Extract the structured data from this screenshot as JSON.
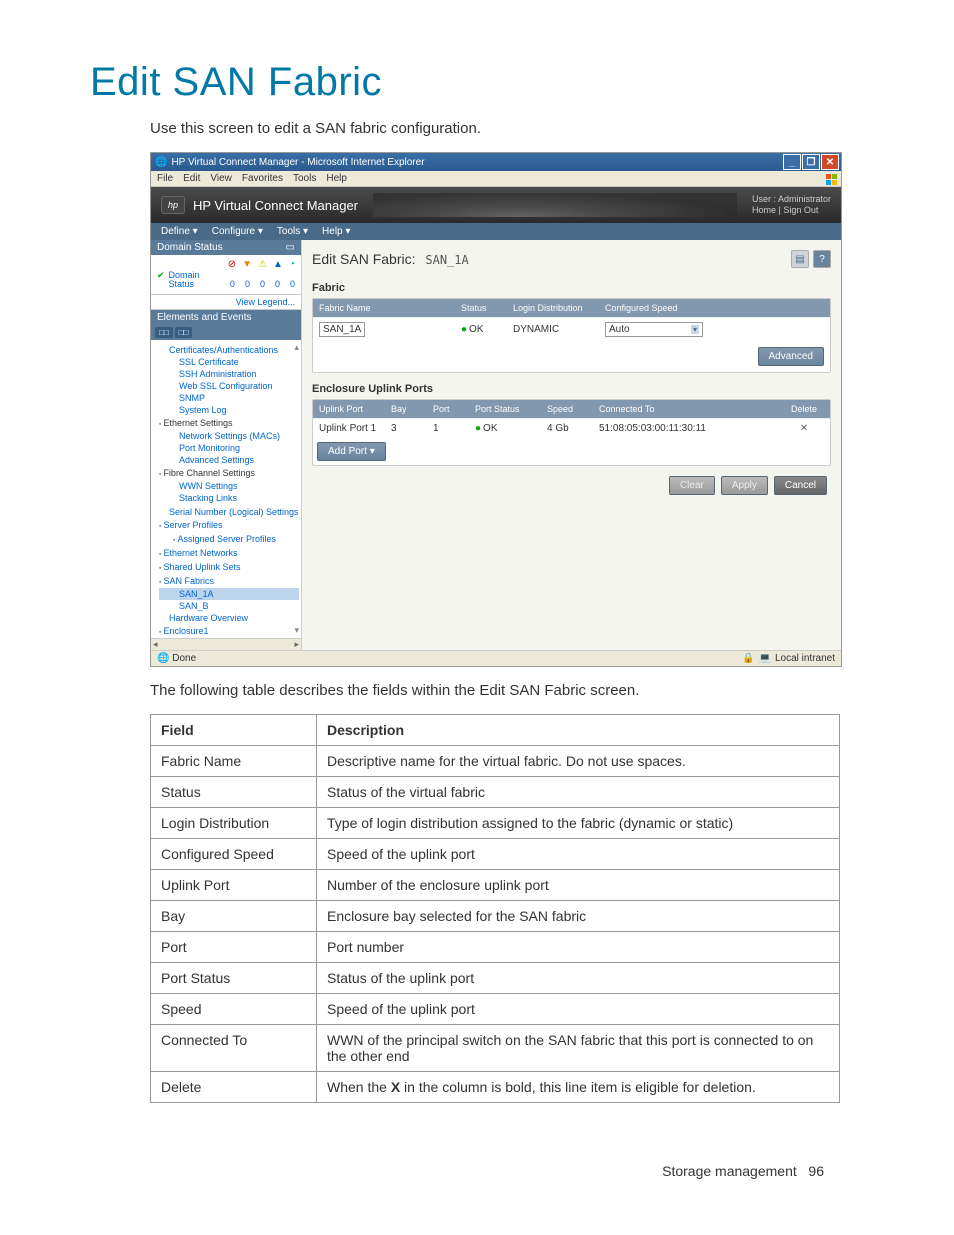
{
  "page": {
    "title": "Edit SAN Fabric",
    "intro": "Use this screen to edit a SAN fabric configuration.",
    "table_intro": "The following table describes the fields within the Edit SAN Fabric screen."
  },
  "browser": {
    "title": "HP Virtual Connect Manager - Microsoft Internet Explorer",
    "menu": [
      "File",
      "Edit",
      "View",
      "Favorites",
      "Tools",
      "Help"
    ],
    "status_done": "Done",
    "status_zone": "Local intranet"
  },
  "app": {
    "title": "HP Virtual Connect Manager",
    "user_label": "User : Administrator",
    "links": "Home  |  Sign Out",
    "menu": [
      "Define ▾",
      "Configure ▾",
      "Tools ▾",
      "Help ▾"
    ]
  },
  "sidebar": {
    "domain_status": "Domain Status",
    "domain_label": "Domain",
    "status_label": "Status",
    "nums": [
      "0",
      "0",
      "0",
      "0",
      "0"
    ],
    "view_legend": "View Legend...",
    "elements_events": "Elements and Events",
    "items": [
      "Certificates/Authentications",
      "SSL Certificate",
      "SSH Administration",
      "Web SSL Configuration",
      "SNMP",
      "System Log",
      "Ethernet Settings",
      "Network Settings (MACs)",
      "Port Monitoring",
      "Advanced Settings",
      "Fibre Channel Settings",
      "WWN Settings",
      "Stacking Links",
      "",
      "Serial Number (Logical) Settings",
      "Server Profiles",
      "Assigned Server Profiles",
      "Ethernet Networks",
      "Shared Uplink Sets",
      "SAN Fabrics",
      "SAN_1A",
      "SAN_B",
      "Hardware Overview",
      "Enclosure1"
    ]
  },
  "content": {
    "title_prefix": "Edit SAN Fabric:",
    "title_name": "SAN_1A",
    "fabric_label": "Fabric",
    "fabric_headers": [
      "Fabric Name",
      "Status",
      "Login Distribution",
      "Configured Speed"
    ],
    "fabric_name_value": "SAN_1A",
    "fabric_status": "OK",
    "fabric_login_dist": "DYNAMIC",
    "fabric_speed": "Auto",
    "advanced_btn": "Advanced",
    "uplink_label": "Enclosure Uplink Ports",
    "uplink_headers": [
      "Uplink Port",
      "Bay",
      "Port",
      "Port Status",
      "Speed",
      "Connected To",
      "Delete"
    ],
    "uplink_row": {
      "port_name": "Uplink Port 1",
      "bay": "3",
      "port": "1",
      "status": "OK",
      "speed": "4 Gb",
      "connected": "51:08:05:03:00:11:30:11",
      "del": "✕"
    },
    "add_port_btn": "Add Port ▾",
    "clear_btn": "Clear",
    "apply_btn": "Apply",
    "cancel_btn": "Cancel"
  },
  "fields_table": {
    "h1": "Field",
    "h2": "Description",
    "rows": [
      {
        "f": "Fabric Name",
        "d": "Descriptive name for the virtual fabric. Do not use spaces."
      },
      {
        "f": "Status",
        "d": "Status of the virtual fabric"
      },
      {
        "f": "Login Distribution",
        "d": "Type of login distribution assigned to the fabric (dynamic or static)"
      },
      {
        "f": "Configured Speed",
        "d": "Speed of the uplink port"
      },
      {
        "f": "Uplink Port",
        "d": "Number of the enclosure uplink port"
      },
      {
        "f": "Bay",
        "d": "Enclosure bay selected for the SAN fabric"
      },
      {
        "f": "Port",
        "d": "Port number"
      },
      {
        "f": "Port Status",
        "d": "Status of the uplink port"
      },
      {
        "f": "Speed",
        "d": "Speed of the uplink port"
      },
      {
        "f": "Connected To",
        "d": "WWN of the principal switch on the SAN fabric that this port is connected to on the other end"
      },
      {
        "f": "Delete",
        "d": "When the X in the column is bold, this line item is eligible for deletion."
      }
    ]
  },
  "footer": {
    "section": "Storage management",
    "page": "96"
  }
}
